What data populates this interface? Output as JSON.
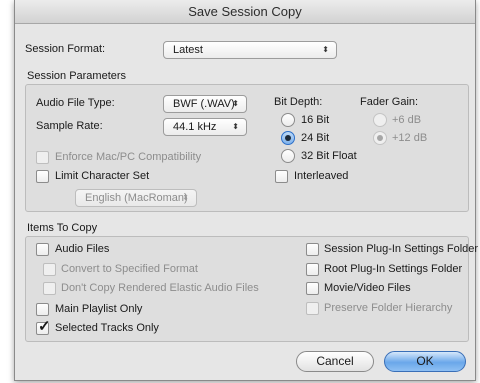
{
  "window": {
    "title": "Save Session Copy"
  },
  "session_format": {
    "label": "Session Format:",
    "value": "Latest"
  },
  "session_parameters": {
    "title": "Session Parameters",
    "audio_file_type": {
      "label": "Audio File Type:",
      "value": "BWF (.WAV)"
    },
    "sample_rate": {
      "label": "Sample Rate:",
      "value": "44.1 kHz"
    },
    "enforce_compat": {
      "label": "Enforce Mac/PC Compatibility",
      "checked": false,
      "enabled": false
    },
    "limit_charset": {
      "label": "Limit Character Set",
      "checked": false,
      "enabled": true
    },
    "charset_popup": {
      "value": "English (MacRoman)",
      "enabled": false
    },
    "bit_depth": {
      "label": "Bit Depth:",
      "options": [
        "16 Bit",
        "24 Bit",
        "32 Bit Float"
      ],
      "selected": "24 Bit"
    },
    "fader_gain": {
      "label": "Fader Gain:",
      "options": [
        "+6 dB",
        "+12 dB"
      ],
      "selected": "+12 dB",
      "enabled": false
    },
    "interleaved": {
      "label": "Interleaved",
      "checked": false
    }
  },
  "items_to_copy": {
    "title": "Items To Copy",
    "audio_files": {
      "label": "Audio Files",
      "checked": false
    },
    "convert_format": {
      "label": "Convert to Specified Format",
      "checked": false,
      "enabled": false
    },
    "dont_copy_elastic": {
      "label": "Don't Copy Rendered Elastic Audio Files",
      "checked": false,
      "enabled": false
    },
    "main_playlist_only": {
      "label": "Main Playlist Only",
      "checked": false
    },
    "selected_tracks_only": {
      "label": "Selected Tracks Only",
      "checked": true
    },
    "session_plugin_settings": {
      "label": "Session Plug-In Settings Folder",
      "checked": false
    },
    "root_plugin_settings": {
      "label": "Root Plug-In Settings Folder",
      "checked": false
    },
    "movie_video_files": {
      "label": "Movie/Video Files",
      "checked": false
    },
    "preserve_folder_hierarchy": {
      "label": "Preserve Folder Hierarchy",
      "checked": false,
      "enabled": false
    }
  },
  "buttons": {
    "cancel": "Cancel",
    "ok": "OK"
  },
  "colors": {
    "default_button": "#6aa7ea",
    "radio_selected": "#7fb2ec",
    "window_bg": "#e6e6e6"
  }
}
